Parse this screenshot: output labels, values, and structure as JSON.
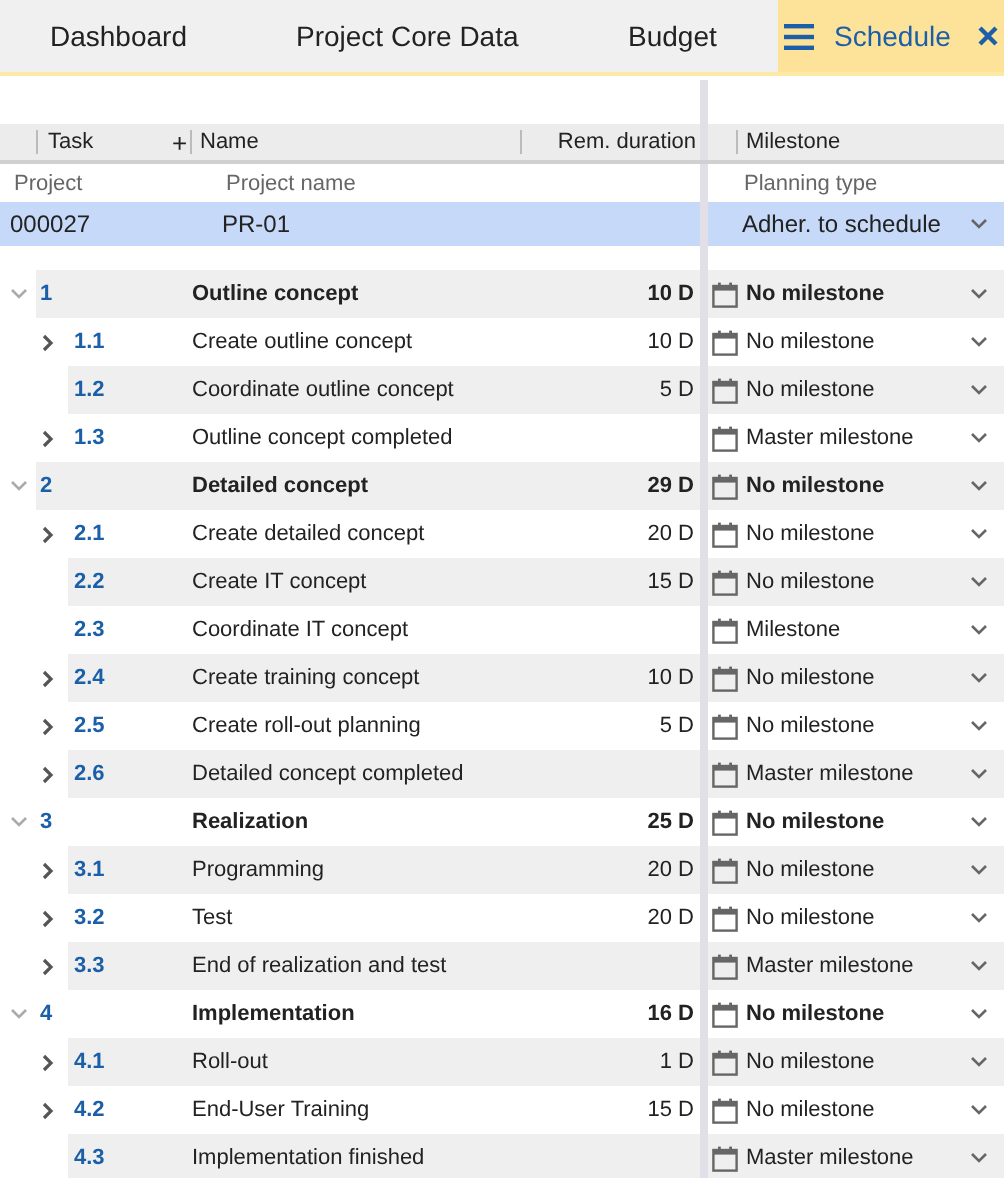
{
  "tabs": [
    {
      "label": "Dashboard",
      "selected": false
    },
    {
      "label": "Project Core Data",
      "selected": false
    },
    {
      "label": "Budget",
      "selected": false
    },
    {
      "label": "Schedule",
      "selected": true
    }
  ],
  "columns": {
    "task": "Task",
    "add": "+",
    "name": "Name",
    "duration": "Rem. duration",
    "milestone": "Milestone"
  },
  "sub_header": {
    "project": "Project",
    "project_name": "Project name",
    "planning_type": "Planning type"
  },
  "project": {
    "number": "000027",
    "name": "PR-01",
    "planning_type": "Adher. to schedule",
    "selected": true
  },
  "tasks": [
    {
      "number": "1",
      "name": "Outline concept",
      "duration": "10 D",
      "milestone": "No milestone",
      "expanded": true,
      "children": [
        {
          "number": "1.1",
          "name": "Create outline concept",
          "duration": "10 D",
          "milestone": "No milestone",
          "expandable": true
        },
        {
          "number": "1.2",
          "name": "Coordinate outline concept",
          "duration": "5 D",
          "milestone": "No milestone",
          "expandable": false
        },
        {
          "number": "1.3",
          "name": "Outline concept completed",
          "milestone": "Master milestone",
          "expandable": true
        }
      ]
    },
    {
      "number": "2",
      "name": "Detailed concept",
      "duration": "29 D",
      "milestone": "No milestone",
      "expanded": true,
      "children": [
        {
          "number": "2.1",
          "name": "Create detailed concept",
          "duration": "20 D",
          "milestone": "No milestone",
          "expandable": true
        },
        {
          "number": "2.2",
          "name": "Create IT concept",
          "duration": "15 D",
          "milestone": "No milestone",
          "expandable": false
        },
        {
          "number": "2.3",
          "name": "Coordinate IT concept",
          "milestone": "Milestone",
          "expandable": false
        },
        {
          "number": "2.4",
          "name": "Create training concept",
          "duration": "10 D",
          "milestone": "No milestone",
          "expandable": true
        },
        {
          "number": "2.5",
          "name": "Create roll-out planning",
          "duration": "5 D",
          "milestone": "No milestone",
          "expandable": true
        },
        {
          "number": "2.6",
          "name": "Detailed concept completed",
          "milestone": "Master milestone",
          "expandable": true
        }
      ]
    },
    {
      "number": "3",
      "name": "Realization",
      "duration": "25 D",
      "milestone": "No milestone",
      "expanded": true,
      "children": [
        {
          "number": "3.1",
          "name": "Programming",
          "duration": "20 D",
          "milestone": "No milestone",
          "expandable": true
        },
        {
          "number": "3.2",
          "name": "Test",
          "duration": "20 D",
          "milestone": "No milestone",
          "expandable": true
        },
        {
          "number": "3.3",
          "name": "End of realization and test",
          "milestone": "Master milestone",
          "expandable": true
        }
      ]
    },
    {
      "number": "4",
      "name": "Implementation",
      "duration": "16 D",
      "milestone": "No milestone",
      "expanded": true,
      "children": [
        {
          "number": "4.1",
          "name": "Roll-out",
          "duration": "1 D",
          "milestone": "No milestone",
          "expandable": true
        },
        {
          "number": "4.2",
          "name": "End-User Training",
          "duration": "15 D",
          "milestone": "No milestone",
          "expandable": true
        },
        {
          "number": "4.3",
          "name": "Implementation finished",
          "milestone": "Master milestone",
          "expandable": false
        }
      ]
    }
  ]
}
